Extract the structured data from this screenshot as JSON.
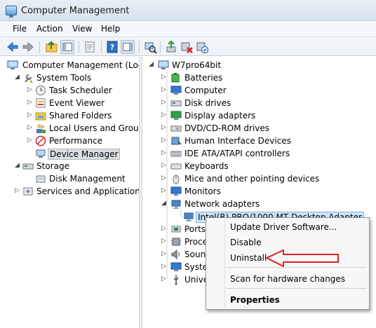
{
  "window": {
    "title": "Computer Management"
  },
  "menu": [
    "File",
    "Action",
    "View",
    "Help"
  ],
  "left_tree": {
    "root": "Computer Management (Local",
    "system_tools": "System Tools",
    "task_scheduler": "Task Scheduler",
    "event_viewer": "Event Viewer",
    "shared_folders": "Shared Folders",
    "local_users": "Local Users and Groups",
    "performance": "Performance",
    "device_manager": "Device Manager",
    "storage": "Storage",
    "disk_management": "Disk Management",
    "services": "Services and Applications"
  },
  "right_tree": {
    "root": "W7pro64bit",
    "batteries": "Batteries",
    "computer": "Computer",
    "disk_drives": "Disk drives",
    "display_adapters": "Display adapters",
    "dvd": "DVD/CD-ROM drives",
    "hid": "Human Interface Devices",
    "ide": "IDE ATA/ATAPI controllers",
    "keyboards": "Keyboards",
    "mice": "Mice and other pointing devices",
    "monitors": "Monitors",
    "network_adapters": "Network adapters",
    "intel_nic": "Intel(R) PRO/1000 MT Desktop Adapter",
    "ports": "Ports",
    "processors": "Proce",
    "sound": "Sounc",
    "system": "Syster",
    "universal": "Unive"
  },
  "context_menu": {
    "update": "Update Driver Software...",
    "disable": "Disable",
    "uninstall": "Uninstall",
    "scan": "Scan for hardware changes",
    "properties": "Properties"
  },
  "colors": {
    "arrow": "#e02020",
    "selection": "#cce4f7"
  }
}
